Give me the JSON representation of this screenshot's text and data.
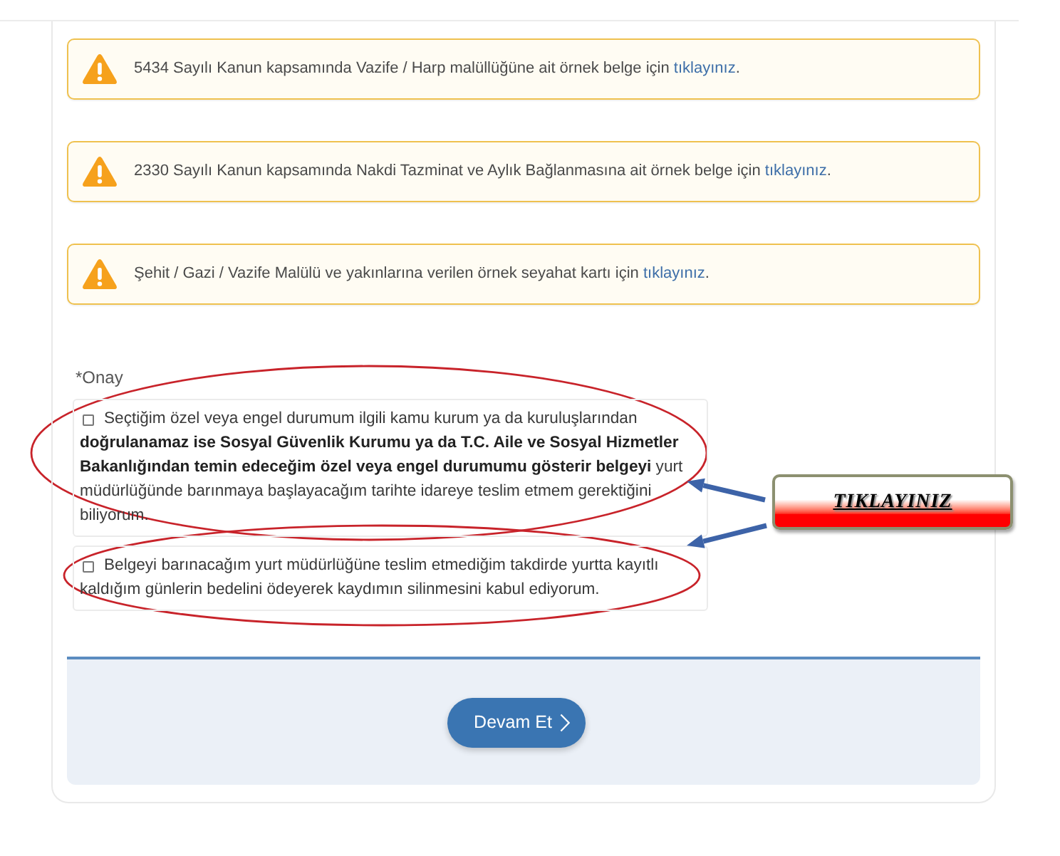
{
  "notices": [
    {
      "text": "5434 Sayılı Kanun kapsamında Vazife / Harp malüllüğüne ait örnek belge için",
      "link": "tıklayınız",
      "after": "."
    },
    {
      "text": "2330 Sayılı Kanun kapsamında Nakdi Tazminat ve Aylık Bağlanmasına ait örnek belge için",
      "link": "tıklayınız",
      "after": "."
    },
    {
      "text": "Şehit / Gazi / Vazife Malülü ve yakınlarına verilen örnek seyahat kartı için",
      "link": "tıklayınız",
      "after": "."
    }
  ],
  "consent": {
    "label": "*Onay",
    "items": [
      {
        "text": "Seçtiğim özel veya engel durumum ilgili kamu kurum ya da kuruluşlarından **doğrulanamaz ise Sosyal Güvenlik Kurumu ya da T.C. Aile ve Sosyal Hizmetler Bakanlığından temin edeceğim özel veya engel durumumu gösterir belgeyi** yurt müdürlüğünde barınmaya başlayacağım tarihte idareye teslim etmem gerektiğini biliyorum.",
        "checked": false
      },
      {
        "text": "Belgeyi barınacağım yurt müdürlüğüne teslim etmediğim takdirde yurtta kayıtlı kaldığım günlerin bedelini ödeyerek kaydımın silinmesini kabul ediyorum.",
        "checked": false
      }
    ]
  },
  "footer": {
    "button": "Devam Et"
  },
  "annotation": {
    "button": "TIKLAYINIZ"
  }
}
